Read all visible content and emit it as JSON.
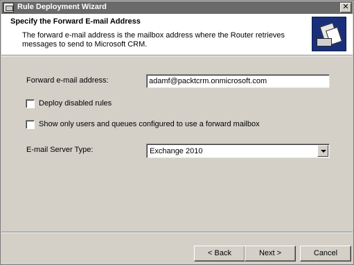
{
  "window": {
    "title": "Rule Deployment Wizard",
    "close_label": "✕"
  },
  "header": {
    "heading": "Specify the Forward E-mail Address",
    "description": "The forward e-mail address is the mailbox address where the Router retrieves messages to send to Microsoft CRM."
  },
  "form": {
    "forward_email_label": "Forward e-mail address:",
    "forward_email_value": "adamf@packtcrm.onmicrosoft.com",
    "deploy_disabled_label": "Deploy disabled rules",
    "deploy_disabled_checked": false,
    "show_only_label": "Show only users and queues configured to use a forward mailbox",
    "show_only_checked": false,
    "server_type_label": "E-mail Server Type:",
    "server_type_value": "Exchange 2010"
  },
  "buttons": {
    "back": "< Back",
    "next": "Next >",
    "cancel": "Cancel"
  },
  "colors": {
    "titlebar": "#6a6a6a",
    "dialog": "#d4d0c8",
    "header": "#ffffff",
    "wizard_icon": "#1a2f7a"
  },
  "icons": {
    "app": "wizard-app-icon",
    "header": "envelope-documents-icon",
    "close": "close-icon",
    "dropdown": "chevron-down-icon"
  }
}
